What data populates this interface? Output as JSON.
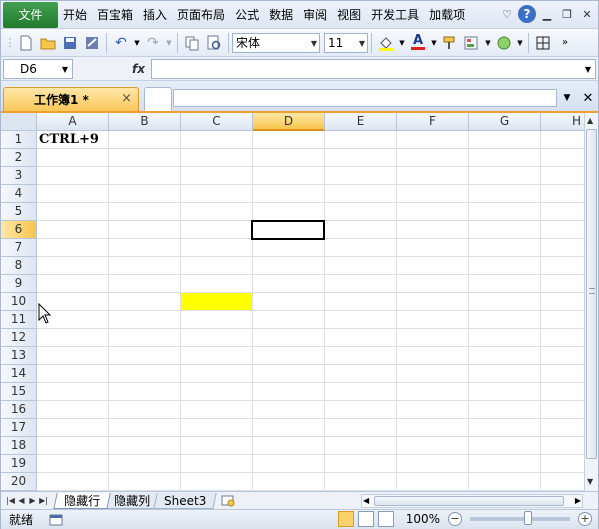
{
  "menubar": {
    "file_label": "文件",
    "items": [
      "开始",
      "百宝箱",
      "插入",
      "页面布局",
      "公式",
      "数据",
      "审阅",
      "视图",
      "开发工具",
      "加载项"
    ],
    "help": "?"
  },
  "toolbar": {
    "font_name": "宋体",
    "font_size": "11",
    "font_color_label": "A"
  },
  "formula_bar": {
    "name_box": "D6",
    "fx_label": "fx",
    "value": ""
  },
  "doc_tab": {
    "label": "工作簿1 *",
    "close": "×"
  },
  "grid": {
    "columns": [
      "A",
      "B",
      "C",
      "D",
      "E",
      "F",
      "G",
      "H"
    ],
    "rows": [
      "1",
      "2",
      "3",
      "4",
      "5",
      "6",
      "7",
      "8",
      "9",
      "10",
      "11",
      "12",
      "13",
      "14",
      "15",
      "16",
      "17",
      "18",
      "19",
      "20"
    ],
    "selected_column": "D",
    "selected_row": "6",
    "cell_A1": "CTRL+9",
    "highlight_color": "#ffff00"
  },
  "sheets": {
    "tabs": [
      "隐藏行",
      "隐藏列",
      "Sheet3"
    ],
    "active": 0
  },
  "status": {
    "text": "就绪",
    "zoom": "100%"
  },
  "colors": {
    "file_button": "#2f8f3c",
    "selected_header": "#f8c44c",
    "highlight": "#ffff00"
  }
}
